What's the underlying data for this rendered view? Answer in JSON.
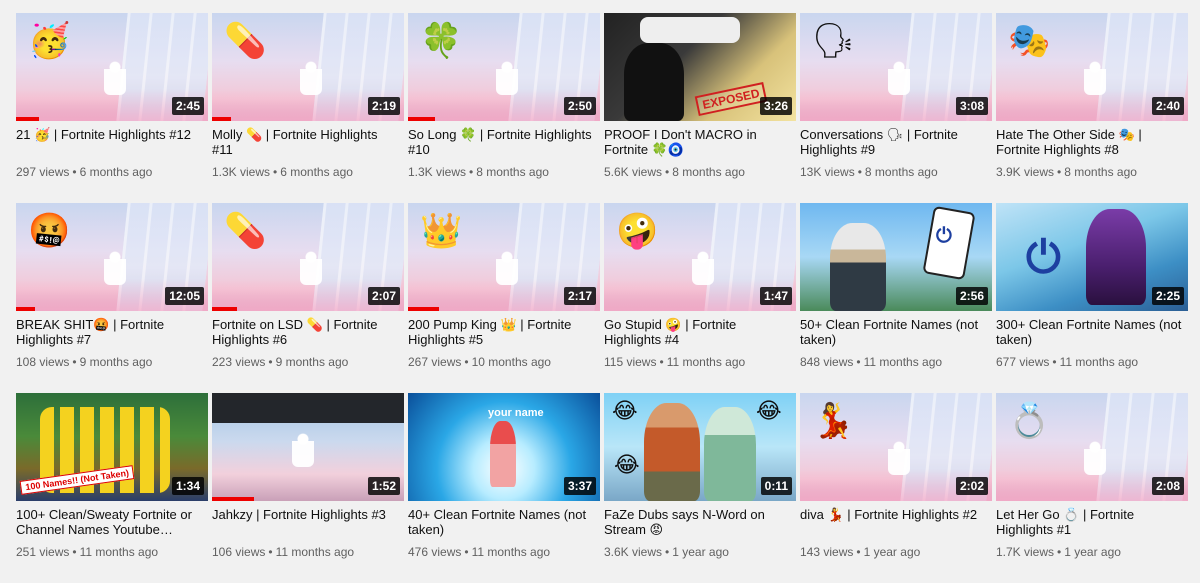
{
  "videos": [
    {
      "title": "21 🥳 | Fortnite Highlights #12",
      "views": "297 views",
      "age": "6 months ago",
      "duration": "2:45",
      "emoji": "🥳",
      "progress": 12
    },
    {
      "title": "Molly 💊 | Fortnite Highlights #11",
      "views": "1.3K views",
      "age": "6 months ago",
      "duration": "2:19",
      "emoji": "💊",
      "progress": 10
    },
    {
      "title": "So Long 🍀 | Fortnite Highlights #10",
      "views": "1.3K views",
      "age": "8 months ago",
      "duration": "2:50",
      "emoji": "🍀",
      "progress": 14
    },
    {
      "title": "PROOF I Don't MACRO in Fortnite 🍀🧿",
      "views": "5.6K views",
      "age": "8 months ago",
      "duration": "3:26",
      "emoji": "",
      "progress": 0,
      "stamp": "EXPOSED"
    },
    {
      "title": "Conversations 🗣 | Fortnite Highlights #9",
      "views": "13K views",
      "age": "8 months ago",
      "duration": "3:08",
      "emoji": "🗣",
      "progress": 0
    },
    {
      "title": "Hate The Other Side 🎭 | Fortnite Highlights #8",
      "views": "3.9K views",
      "age": "8 months ago",
      "duration": "2:40",
      "emoji": "🎭",
      "progress": 0
    },
    {
      "title": "BREAK SHIT🤬 | Fortnite Highlights #7",
      "views": "108 views",
      "age": "9 months ago",
      "duration": "12:05",
      "emoji": "🤬",
      "progress": 10
    },
    {
      "title": "Fortnite on LSD 💊 | Fortnite Highlights #6",
      "views": "223 views",
      "age": "9 months ago",
      "duration": "2:07",
      "emoji": "💊",
      "progress": 13
    },
    {
      "title": "200 Pump King 👑 | Fortnite Highlights #5",
      "views": "267 views",
      "age": "10 months ago",
      "duration": "2:17",
      "emoji": "👑",
      "progress": 16
    },
    {
      "title": "Go Stupid 🤪 | Fortnite Highlights #4",
      "views": "115 views",
      "age": "11 months ago",
      "duration": "1:47",
      "emoji": "🤪",
      "progress": 0
    },
    {
      "title": "50+ Clean Fortnite Names (not taken)",
      "views": "848 views",
      "age": "11 months ago",
      "duration": "2:56",
      "emoji": "",
      "progress": 0
    },
    {
      "title": "300+ Clean Fortnite Names (not taken)",
      "views": "677 views",
      "age": "11 months ago",
      "duration": "2:25",
      "emoji": "",
      "progress": 0
    },
    {
      "title": "100+ Clean/Sweaty Fortnite or Channel Names Youtube…",
      "views": "251 views",
      "age": "11 months ago",
      "duration": "1:34",
      "emoji": "",
      "progress": 0,
      "banner": "100 Names!! (Not Taken)"
    },
    {
      "title": "Jahkzy | Fortnite Highlights #3",
      "views": "106 views",
      "age": "11 months ago",
      "duration": "1:52",
      "emoji": "",
      "progress": 22
    },
    {
      "title": "40+ Clean Fortnite Names (not taken)",
      "views": "476 views",
      "age": "11 months ago",
      "duration": "3:37",
      "emoji": "",
      "progress": 0,
      "overlay": "your name"
    },
    {
      "title": "FaZe Dubs says N-Word on Stream 😡",
      "views": "3.6K views",
      "age": "1 year ago",
      "duration": "0:11",
      "emoji": "😂",
      "progress": 0
    },
    {
      "title": "diva 💃 | Fortnite Highlights #2",
      "views": "143 views",
      "age": "1 year ago",
      "duration": "2:02",
      "emoji": "💃",
      "progress": 0
    },
    {
      "title": "Let Her Go 💍 | Fortnite Highlights #1",
      "views": "1.7K views",
      "age": "1 year ago",
      "duration": "2:08",
      "emoji": "💍",
      "progress": 0
    }
  ]
}
